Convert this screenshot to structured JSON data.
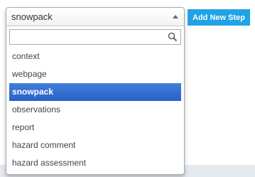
{
  "step_select": {
    "selected_value": "snowpack",
    "search": {
      "value": "",
      "placeholder": ""
    },
    "options": [
      {
        "label": "context",
        "selected": false
      },
      {
        "label": "webpage",
        "selected": false
      },
      {
        "label": "snowpack",
        "selected": true
      },
      {
        "label": "observations",
        "selected": false
      },
      {
        "label": "report",
        "selected": false
      },
      {
        "label": "hazard comment",
        "selected": false
      },
      {
        "label": "hazard assessment",
        "selected": false
      }
    ]
  },
  "add_step_button": {
    "label": "Add New Step"
  },
  "colors": {
    "selected_option": "#3366cc",
    "button": "#1fa3e6",
    "bottom_strip": "#e4e9ef"
  },
  "icons": {
    "search": "search-icon",
    "dropdown_arrow": "chevron-up-icon"
  }
}
